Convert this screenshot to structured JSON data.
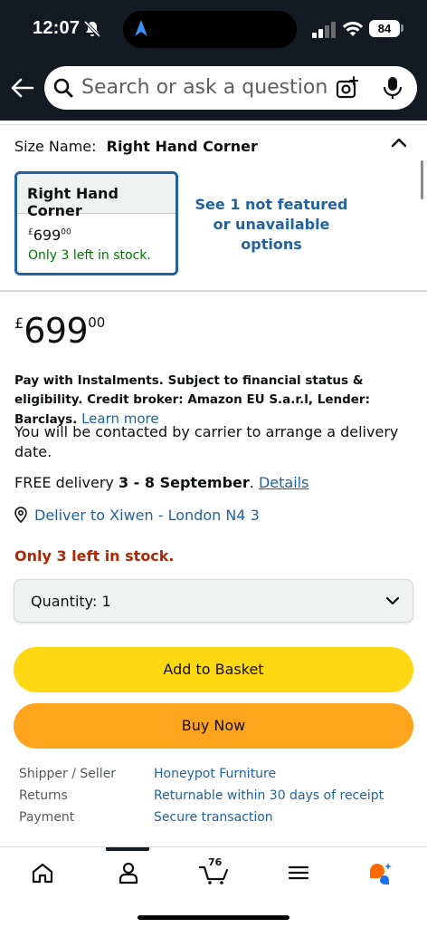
{
  "status_bar": {
    "time": "12:07",
    "battery": "84"
  },
  "search": {
    "placeholder": "Search or ask a question"
  },
  "variation": {
    "label": "Size Name:",
    "selected": "Right Hand Corner",
    "swatch": {
      "title": "Right Hand Corner",
      "price_currency": "£",
      "price_whole": "699",
      "price_fraction": "00",
      "stock": "Only 3 left in stock."
    },
    "unavailable_link": "See 1 not featured or unavailable options"
  },
  "price": {
    "currency": "£",
    "whole": "699",
    "fraction": "00"
  },
  "instalments": {
    "text": "Pay with Instalments. Subject to financial status & eligibility. Credit broker: Amazon EU S.a.r.l, Lender: Barclays.",
    "link": "Learn more"
  },
  "contact_note": "You will be contacted by carrier to arrange a delivery date.",
  "delivery": {
    "prefix": "FREE delivery ",
    "dates": "3 - 8 September",
    "suffix": ". ",
    "details_link": "Details"
  },
  "deliver_to": "Deliver to Xiwen - London N4 3",
  "stock_warning": "Only 3 left in stock.",
  "quantity": {
    "label": "Quantity: 1"
  },
  "buttons": {
    "add_to_basket": "Add to Basket",
    "buy_now": "Buy Now"
  },
  "info_rows": [
    {
      "key": "Shipper / Seller",
      "value": "Honeypot Furniture"
    },
    {
      "key": "Returns",
      "value": "Returnable within 30 days of receipt"
    },
    {
      "key": "Payment",
      "value": "Secure transaction"
    }
  ],
  "tab_bar": {
    "cart_count": "76"
  },
  "colors": {
    "header_bg": "#131a22",
    "link": "#2162a1",
    "in_stock": "#007600",
    "low_stock": "#b12704",
    "add_to_basket": "#ffd814",
    "buy_now": "#ffa41c"
  },
  "icons": [
    "bell-muted-icon",
    "navigation-arrow-icon",
    "cellular-signal-icon",
    "wifi-icon",
    "back-arrow-icon",
    "search-icon",
    "camera-icon",
    "microphone-icon",
    "chevron-up-icon",
    "location-pin-icon",
    "chevron-down-icon",
    "home-icon",
    "account-icon",
    "cart-icon",
    "menu-icon",
    "rufus-assistant-icon"
  ]
}
